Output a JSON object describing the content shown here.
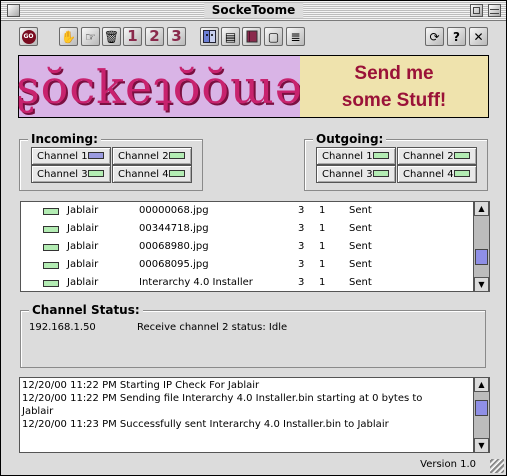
{
  "window": {
    "title": "SockeToome"
  },
  "toolbar": {
    "go": "GO",
    "numbers": [
      "1",
      "2",
      "3"
    ]
  },
  "banner": {
    "logo": "ʂŏckeʇŏŏɯə",
    "tagline_line1": "Send me",
    "tagline_line2": "some Stuff!"
  },
  "incoming": {
    "label": "Incoming:",
    "channels": [
      "Channel 1",
      "Channel 2",
      "Channel 3",
      "Channel 4"
    ]
  },
  "outgoing": {
    "label": "Outgoing:",
    "channels": [
      "Channel 1",
      "Channel 2",
      "Channel 3",
      "Channel 4"
    ]
  },
  "transfers": [
    {
      "user": "Jablair",
      "file": "00000068.jpg",
      "col1": "3",
      "col2": "1",
      "status": "Sent"
    },
    {
      "user": "Jablair",
      "file": "00344718.jpg",
      "col1": "3",
      "col2": "1",
      "status": "Sent"
    },
    {
      "user": "Jablair",
      "file": "00068980.jpg",
      "col1": "3",
      "col2": "1",
      "status": "Sent"
    },
    {
      "user": "Jablair",
      "file": "00068095.jpg",
      "col1": "3",
      "col2": "1",
      "status": "Sent"
    },
    {
      "user": "Jablair",
      "file": "Interarchy 4.0 Installer",
      "col1": "3",
      "col2": "1",
      "status": "Sent"
    }
  ],
  "channel_status": {
    "label": "Channel Status:",
    "ip": "192.168.1.50",
    "message": "Receive channel 2 status: Idle"
  },
  "log": [
    "12/20/00 11:22 PM Starting IP Check For Jablair",
    "12/20/00 11:22 PM Sending file Interarchy 4.0 Installer.bin starting at 0 bytes to",
    "Jablair",
    "12/20/00 11:23 PM Successfully sent Interarchy 4.0 Installer.bin to Jablair"
  ],
  "footer": {
    "version": "Version 1.0"
  },
  "colors": {
    "led_idle": "#b3ecb3",
    "led_active": "#9b9be0",
    "banner_left": "#d9b4e6",
    "banner_right": "#efe3ad",
    "accent": "#9a1238"
  }
}
